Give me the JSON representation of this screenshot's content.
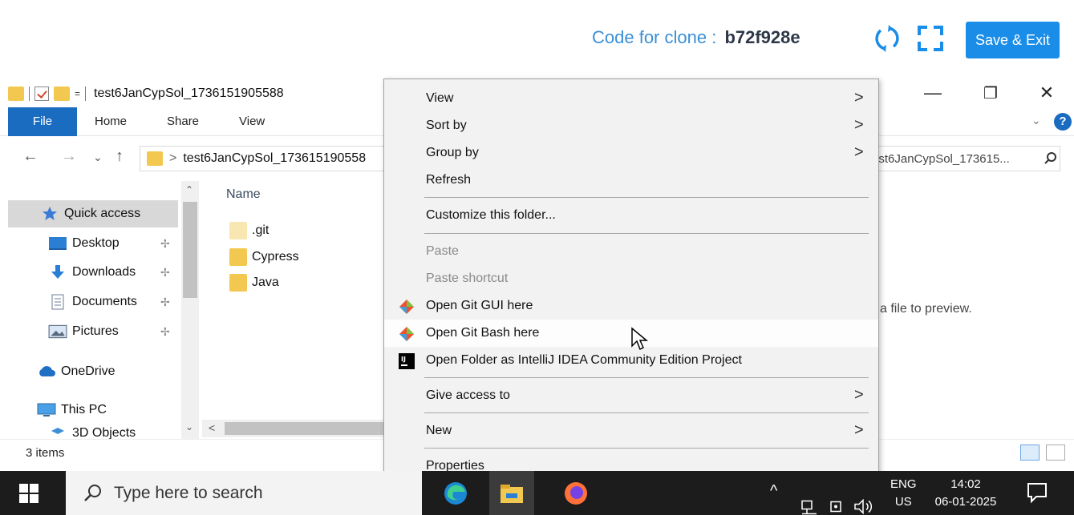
{
  "header": {
    "clone_label": "Code for clone :",
    "clone_code": "b72f928e",
    "save_exit_label": "Save & Exit",
    "accent_color": "#1a8de8"
  },
  "window": {
    "title": "test6JanCypSol_1736151905588",
    "qa_dropdown": "=",
    "minimize": "—",
    "restore": "❐",
    "close": "✕"
  },
  "ribbon": {
    "tabs": [
      "File",
      "Home",
      "Share",
      "View"
    ],
    "help": "?",
    "expand": "⌄"
  },
  "address": {
    "back": "←",
    "forward": "→",
    "recent": "⌄",
    "up": "↑",
    "path_sep": ">",
    "path": "test6JanCypSol_173615190558",
    "search_text": "est6JanCypSol_173615..."
  },
  "nav_pane": {
    "items": [
      {
        "label": "Quick access",
        "icon": "star-icon"
      },
      {
        "label": "Desktop",
        "icon": "desktop-icon"
      },
      {
        "label": "Downloads",
        "icon": "download-icon"
      },
      {
        "label": "Documents",
        "icon": "document-icon"
      },
      {
        "label": "Pictures",
        "icon": "pictures-icon"
      },
      {
        "label": "OneDrive",
        "icon": "cloud-icon"
      },
      {
        "label": "This PC",
        "icon": "computer-icon"
      },
      {
        "label": "3D Objects",
        "icon": "cube-icon"
      }
    ],
    "pin": "📌"
  },
  "content": {
    "column_name": "Name",
    "files": [
      {
        "name": ".git",
        "color": "#f8e7b0"
      },
      {
        "name": "Cypress",
        "color": "#f3c850"
      },
      {
        "name": "Java",
        "color": "#f3c850"
      }
    ]
  },
  "preview_text": "a file to preview.",
  "status": {
    "item_count": "3 items"
  },
  "context_menu": {
    "items": [
      {
        "label": "View",
        "submenu": true
      },
      {
        "label": "Sort by",
        "submenu": true
      },
      {
        "label": "Group by",
        "submenu": true
      },
      {
        "label": "Refresh"
      },
      {
        "label": "Customize this folder..."
      },
      {
        "label": "Paste",
        "disabled": true
      },
      {
        "label": "Paste shortcut",
        "disabled": true
      },
      {
        "label": "Open Git GUI here",
        "icon": "git-icon"
      },
      {
        "label": "Open Git Bash here",
        "icon": "git-icon"
      },
      {
        "label": "Open Folder as IntelliJ IDEA Community Edition Project",
        "icon": "intellij-icon"
      },
      {
        "label": "Give access to",
        "submenu": true
      },
      {
        "label": "New",
        "submenu": true
      },
      {
        "label": "Properties"
      }
    ],
    "submenu_arrow": ">"
  },
  "taskbar": {
    "search_placeholder": "Type here to search",
    "tray_chevron": "^",
    "lang_top": "ENG",
    "lang_bottom": "US",
    "time": "14:02",
    "date": "06-01-2025"
  }
}
